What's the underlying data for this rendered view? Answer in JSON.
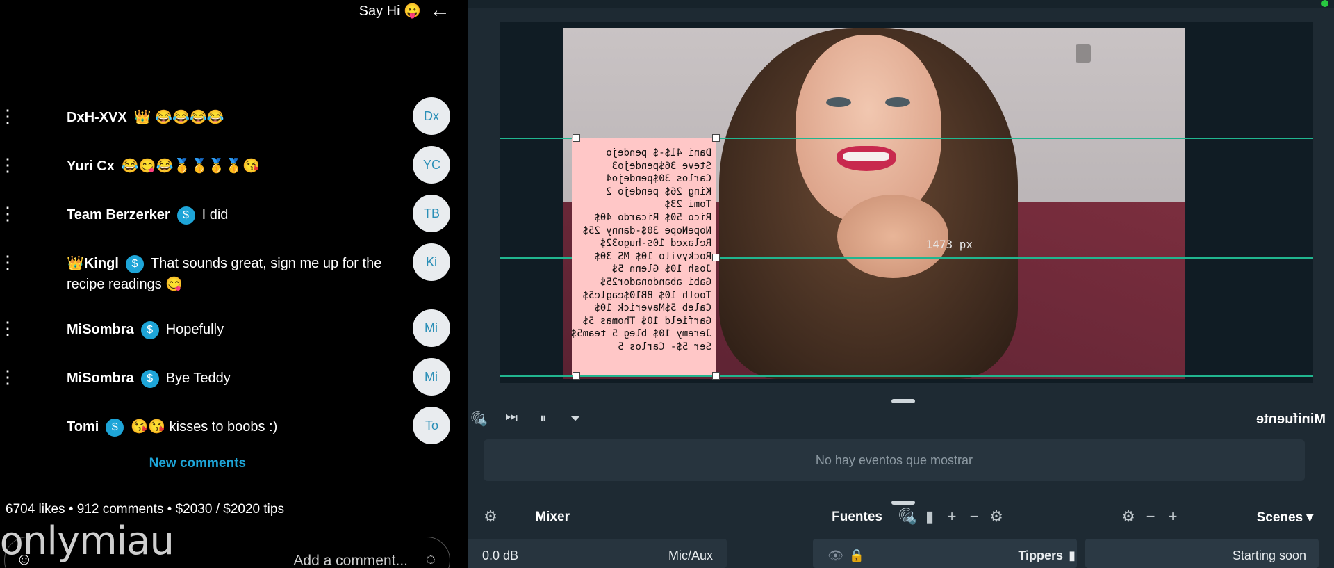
{
  "feed": {
    "say_hi": "Say Hi 😛",
    "arrow_icon": "→",
    "comments": [
      {
        "initials": "Dx",
        "name": "DxH-XVX",
        "text": "👑 😂😂😂😂",
        "tip": false
      },
      {
        "initials": "YC",
        "name": "Yuri Cx",
        "text": "😂😋😂🥇🥇🥇🥇😘",
        "tip": false
      },
      {
        "initials": "TB",
        "name": "Team Berzerker",
        "text": "I did",
        "tip": true
      },
      {
        "initials": "Ki",
        "name": "👑Kingl",
        "text": "That sounds great, sign me up for the recipe readings 😋",
        "tip": true
      },
      {
        "initials": "Mi",
        "name": "MiSombra",
        "text": "Hopefully",
        "tip": true
      },
      {
        "initials": "Mi",
        "name": "MiSombra",
        "text": "Bye Teddy",
        "tip": true
      },
      {
        "initials": "To",
        "name": "Tomi",
        "text": "😘😘 kisses to boobs :)",
        "tip": true
      }
    ],
    "tip_badge": "$",
    "menu_icon": "⋮",
    "new_comments": "New comments",
    "stats": "6704 likes • 912 comments • $2030 / $2020 tips",
    "add_comment_placeholder": "Add a comment...",
    "emoji_icon": "☺",
    "loading_icon": "◌"
  },
  "watermark": "onlymiau",
  "studio": {
    "tipper_lines": [
      "Dani 41$-$ pendejo",
      "Steve 36$pendejo3",
      "Carlos 30$pendejo4",
      "King 26$ pendejo 2",
      "Tomi 23$",
      "Rico 50$ Ricardo 40$",
      "NopeNope 30$-danny 25$",
      "Relaxed 10$-hugo32$",
      "Rockyvito 10$ MS 30$",
      "Josh 10$ Glenn 5$",
      "Gabi abandonador25$",
      "Tooth 10$ BB10$eagle5$",
      "Caleb 5$Maverick 10$",
      "Garfield 10$ Thomas 5$",
      "Jeremy 10$ bleg 5 team5$",
      "Ser 5$- Carlos 5"
    ],
    "px_label": "1473 px",
    "minifuente_title": "Minifuente",
    "events_text": "No hay eventos que mostrar",
    "scenes_title": "Scenes ▾",
    "scene_item": "Starting soon",
    "fuentes_title": "Fuentes",
    "source_item": "Tippers",
    "mixer_title": "Mixer",
    "mixer_channel": "Mic/Aux",
    "mixer_level": "0.0 dB",
    "icons": {
      "filter": "⏷",
      "pause": "⏸",
      "previous": "⏮",
      "audio": "🔊",
      "plus": "+",
      "minus": "−",
      "gear": "⚙",
      "file": "▮",
      "eye": "👁",
      "lock": "🔒"
    }
  }
}
